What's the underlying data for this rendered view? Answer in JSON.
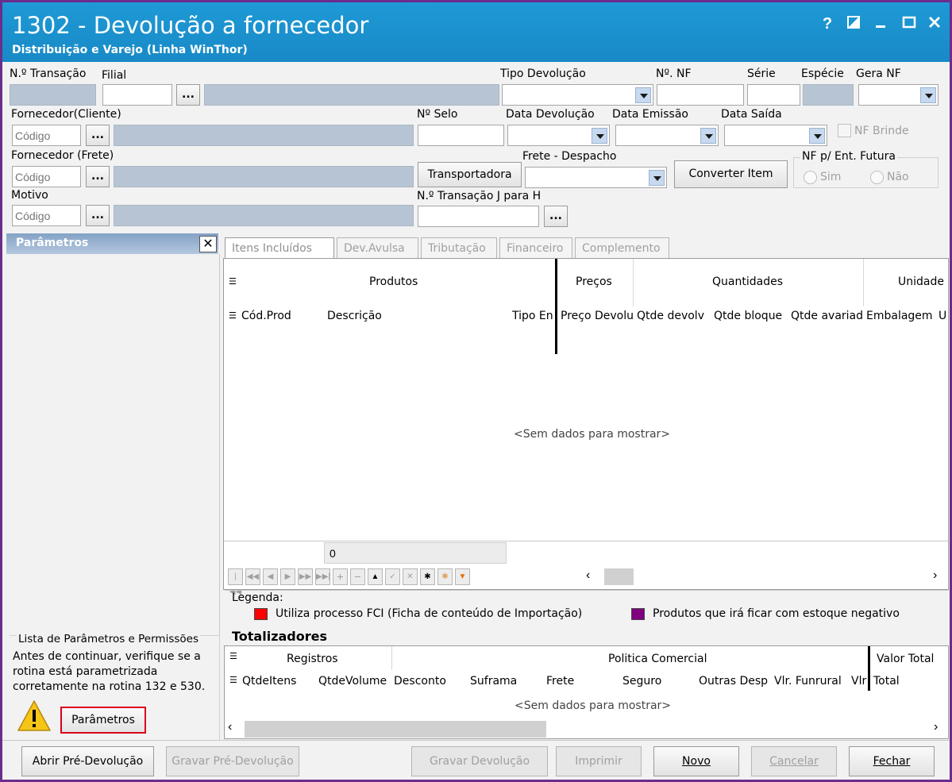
{
  "window": {
    "title": "1302 - Devolução a fornecedor",
    "subtitle": "Distribuição e Varejo (Linha WinThor)",
    "controls": [
      "?",
      "restore-icon",
      "minimize-icon",
      "maximize-icon",
      "close-icon"
    ]
  },
  "form": {
    "labels": {
      "transacao": "N.º Transação",
      "filial": "Filial",
      "tipo_devolucao": "Tipo Devolução",
      "num_nf": "Nº. NF",
      "serie": "Série",
      "especie": "Espécie",
      "gera_nf": "Gera NF",
      "fornecedor_cliente": "Fornecedor(Cliente)",
      "num_selo": "Nº Selo",
      "data_devolucao": "Data Devolução",
      "data_emissao": "Data Emissão",
      "data_saida": "Data Saída",
      "nf_brinde": "NF Brinde",
      "fornecedor_frete": "Fornecedor (Frete)",
      "frete_despacho": "Frete - Despacho",
      "nf_ent_futura": "NF p/ Ent. Futura",
      "sim": "Sim",
      "nao": "Não",
      "motivo": "Motivo",
      "transacao_jh": "N.º Transação J para H"
    },
    "placeholders": {
      "codigo": "Código"
    },
    "buttons": {
      "ellipsis": "...",
      "transportadora": "Transportadora",
      "converter_item": "Converter Item"
    }
  },
  "params_panel": {
    "title": "Parâmetros",
    "close": "✕",
    "section_title": "Lista de Parâmetros e Permissões",
    "message": "Antes de continuar, verifique se a rotina está parametrizada corretamente na rotina 132 e 530.",
    "button": "Parâmetros"
  },
  "tabs": [
    {
      "label": "Itens Incluídos"
    },
    {
      "label": "Dev.Avulsa"
    },
    {
      "label": "Tributação"
    },
    {
      "label": "Financeiro"
    },
    {
      "label": "Complemento"
    }
  ],
  "items_grid": {
    "bands": [
      "Produtos",
      "Preços",
      "Quantidades",
      "Unidade"
    ],
    "columns": [
      "Cód.Prod",
      "Descrição",
      "Tipo En",
      "Preço Devolu",
      "Qtde devolv",
      "Qtde bloque",
      "Qtde avariad",
      "Embalagem",
      "U"
    ],
    "empty": "<Sem dados para mostrar>",
    "footer_count": "0",
    "nav_buttons": [
      "|◀◀",
      "◀◀",
      "◀",
      "▶",
      "▶▶",
      "▶▶|",
      "+",
      "−",
      "▲",
      "✓",
      "✕",
      "✱",
      "✱",
      "▼"
    ]
  },
  "legend": {
    "title": "Legenda:",
    "items": [
      {
        "color": "#ff0000",
        "label": "Utiliza processo FCI (Ficha de conteúdo de Importação)"
      },
      {
        "color": "#800080",
        "label": "Produtos que irá ficar com estoque negativo"
      }
    ]
  },
  "totals": {
    "title": "Totalizadores",
    "bands": [
      "Registros",
      "Politica Comercial",
      "Valor Total"
    ],
    "columns": [
      "QtdeItens",
      "QtdeVolume",
      "Desconto",
      "Suframa",
      "Frete",
      "Seguro",
      "Outras Desp",
      "Vlr. Funrural",
      "Vlr",
      "Total"
    ],
    "empty": "<Sem dados para mostrar>"
  },
  "bottom_buttons": {
    "abrir": "Abrir Pré-Devolução",
    "gravar_pre": "Gravar Pré-Devolução",
    "gravar_dev": "Gravar Devolução",
    "imprimir": "Imprimir",
    "novo": "Novo",
    "cancelar": "Cancelar",
    "fechar": "Fechar"
  }
}
